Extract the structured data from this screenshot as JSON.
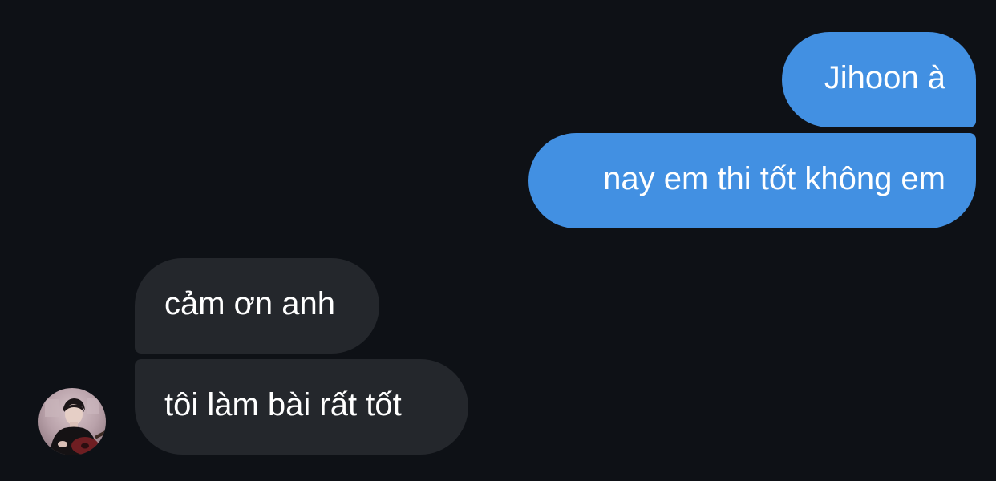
{
  "chat": {
    "messages": [
      {
        "sender": "me",
        "text": "Jihoon à"
      },
      {
        "sender": "me",
        "text": "nay em thi tốt không em"
      },
      {
        "sender": "other",
        "text": "cảm ơn anh"
      },
      {
        "sender": "other",
        "text": "tôi làm bài rất tốt"
      }
    ]
  },
  "colors": {
    "background": "#0e1116",
    "sent_bubble": "#4290e2",
    "received_bubble": "#24272c",
    "text": "#ffffff"
  }
}
